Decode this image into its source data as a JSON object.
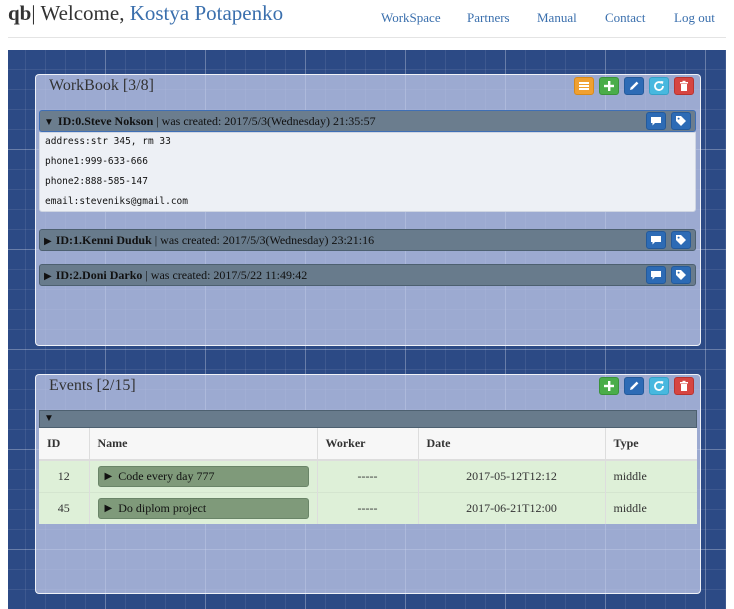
{
  "header": {
    "brand": "qb",
    "welcome": "Welcome,",
    "user": "Kostya Potapenko",
    "nav": [
      "WorkSpace",
      "Partners",
      "Manual",
      "Contact",
      "Log out"
    ]
  },
  "workbook": {
    "title": "WorkBook [3/8]",
    "records": [
      {
        "id_label": "ID:0.Steve Nokson",
        "created": "| was created: 2017/5/3(Wednesday) 21:35:57",
        "expanded": true,
        "fields": [
          {
            "key": "address:",
            "value": "str 345, rm 33"
          },
          {
            "key": "phone1:",
            "value": "999-633-666"
          },
          {
            "key": "phone2:",
            "value": "888-585-147"
          },
          {
            "key": "email:",
            "value": "steveniks@gmail.com"
          }
        ]
      },
      {
        "id_label": "ID:1.Kenni Duduk",
        "created": "| was created: 2017/5/3(Wednesday) 23:21:16",
        "expanded": false
      },
      {
        "id_label": "ID:2.Doni Darko",
        "created": "| was created: 2017/5/22 11:49:42",
        "expanded": false
      }
    ]
  },
  "events": {
    "title": "Events [2/15]",
    "columns": [
      "ID",
      "Name",
      "Worker",
      "Date",
      "Type"
    ],
    "rows": [
      {
        "id": "12",
        "name": "Code every day 777",
        "worker": "-----",
        "date": "2017-05-12T12:12",
        "type": "middle"
      },
      {
        "id": "45",
        "name": "Do diplom project",
        "worker": "-----",
        "date": "2017-06-21T12:00",
        "type": "middle"
      }
    ]
  },
  "icons": {
    "toolbar": [
      "list-icon",
      "plus-icon",
      "pencil-icon",
      "refresh-icon",
      "trash-icon"
    ],
    "record": [
      "comment-icon",
      "tag-icon"
    ]
  },
  "colors": {
    "accent_link": "#3a6fad",
    "blueprint_bg": "#2c4a85",
    "orange": "#f0a030",
    "green": "#4aad4a",
    "blue": "#2d6bb5",
    "cyan": "#48b8df",
    "red": "#d64541",
    "row_success": "#def0d8"
  }
}
